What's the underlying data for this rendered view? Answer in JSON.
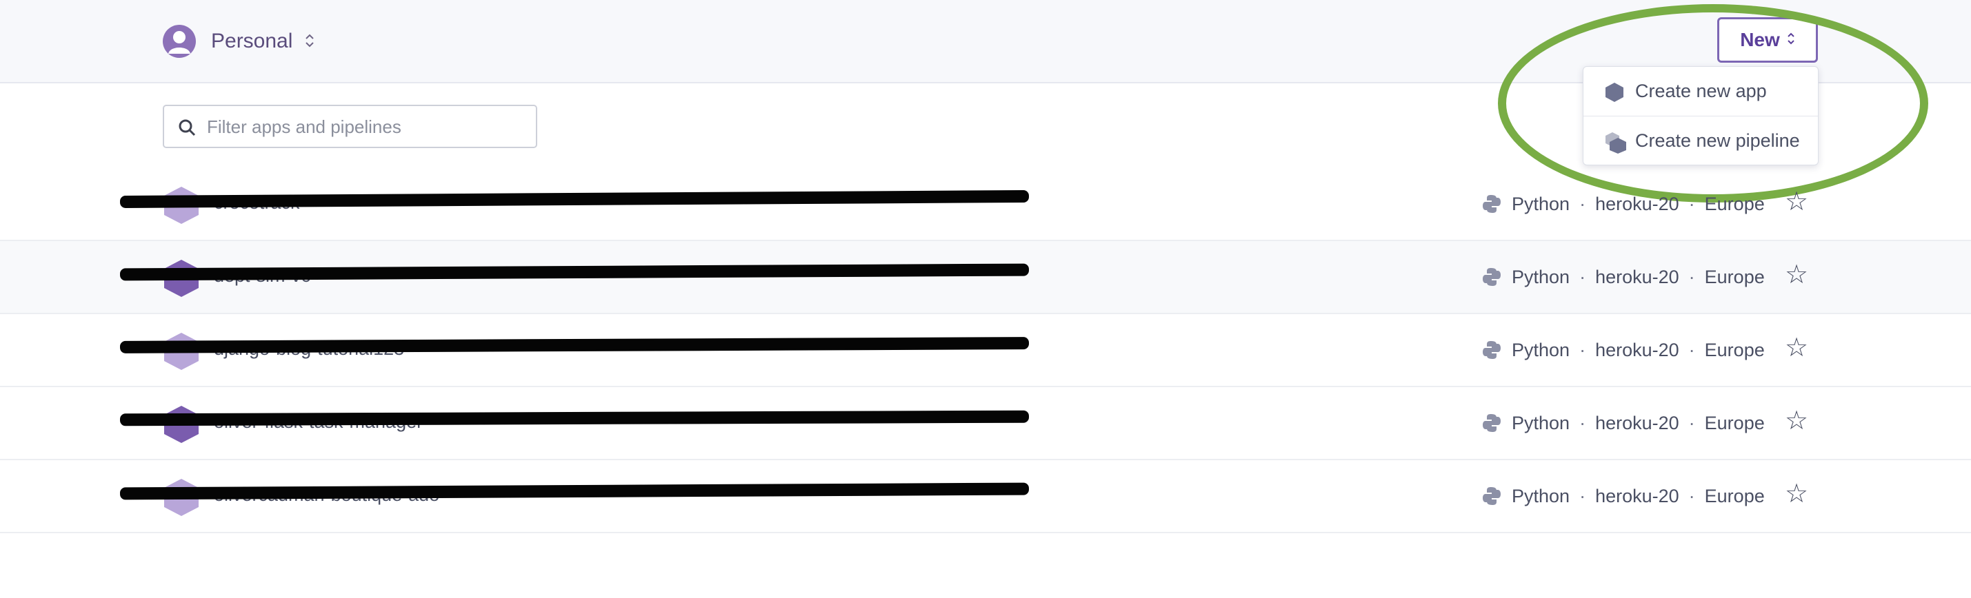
{
  "header": {
    "account_name": "Personal",
    "account_switch_glyph": "◇",
    "new_button_label": "New",
    "new_button_glyph": "◇"
  },
  "new_menu": {
    "items": [
      {
        "label": "Create new app",
        "icon": "app-hexagon-icon"
      },
      {
        "label": "Create new pipeline",
        "icon": "pipeline-icon"
      }
    ]
  },
  "filter": {
    "placeholder": "Filter apps and pipelines",
    "value": ""
  },
  "apps": [
    {
      "name": "crocotrack",
      "language": "Python",
      "stack": "heroku-20",
      "region": "Europe",
      "separator": "·",
      "starred": false,
      "icon_color": "#b8a6d9"
    },
    {
      "name": "dept-sim-v6",
      "language": "Python",
      "stack": "heroku-20",
      "region": "Europe",
      "separator": "·",
      "starred": false,
      "icon_color": "#7a5cae"
    },
    {
      "name": "django-blog-tutorial123",
      "language": "Python",
      "stack": "heroku-20",
      "region": "Europe",
      "separator": "·",
      "starred": false,
      "icon_color": "#b8a6d9"
    },
    {
      "name": "oliver-flask-task-manager",
      "language": "Python",
      "stack": "heroku-20",
      "region": "Europe",
      "separator": "·",
      "starred": false,
      "icon_color": "#7a5cae"
    },
    {
      "name": "olivercadman-boutique-ado",
      "language": "Python",
      "stack": "heroku-20",
      "region": "Europe",
      "separator": "·",
      "starred": false,
      "icon_color": "#b8a6d9"
    }
  ],
  "star_glyph": "☆",
  "colors": {
    "accent": "#7d67b4",
    "highlight_ring": "#79ad45",
    "header_bg": "#f7f8fb"
  }
}
